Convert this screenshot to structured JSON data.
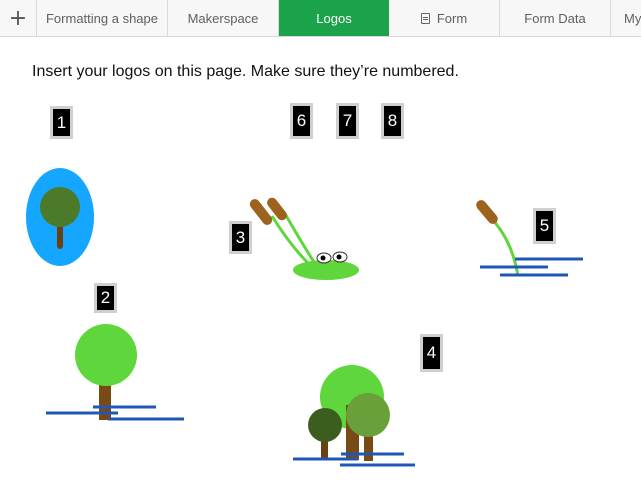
{
  "tabbar": {
    "add_icon": "plus-icon",
    "tabs": [
      {
        "label": "Formatting a shape",
        "active": false
      },
      {
        "label": "Makerspace",
        "active": false
      },
      {
        "label": "Logos",
        "active": true
      },
      {
        "label": "Form",
        "icon": "form-icon",
        "active": false
      },
      {
        "label": "Form Data",
        "active": false
      },
      {
        "label": "My",
        "active": false
      }
    ],
    "active_color": "#1aa34a"
  },
  "page": {
    "instruction": "Insert your logos on this page. Make sure they’re numbered.",
    "labels": [
      "1",
      "2",
      "3",
      "4",
      "5",
      "6",
      "7",
      "8"
    ]
  },
  "colors": {
    "sky_blue": "#15a7ff",
    "leaf_green": "#5fd63b",
    "dark_green": "#4a7a2a",
    "forest_green": "#3b5e1f",
    "moss_green": "#6aa03a",
    "trunk_brown": "#7a4a14",
    "cattail_brown": "#9c621e",
    "water_blue": "#1f57b8"
  }
}
